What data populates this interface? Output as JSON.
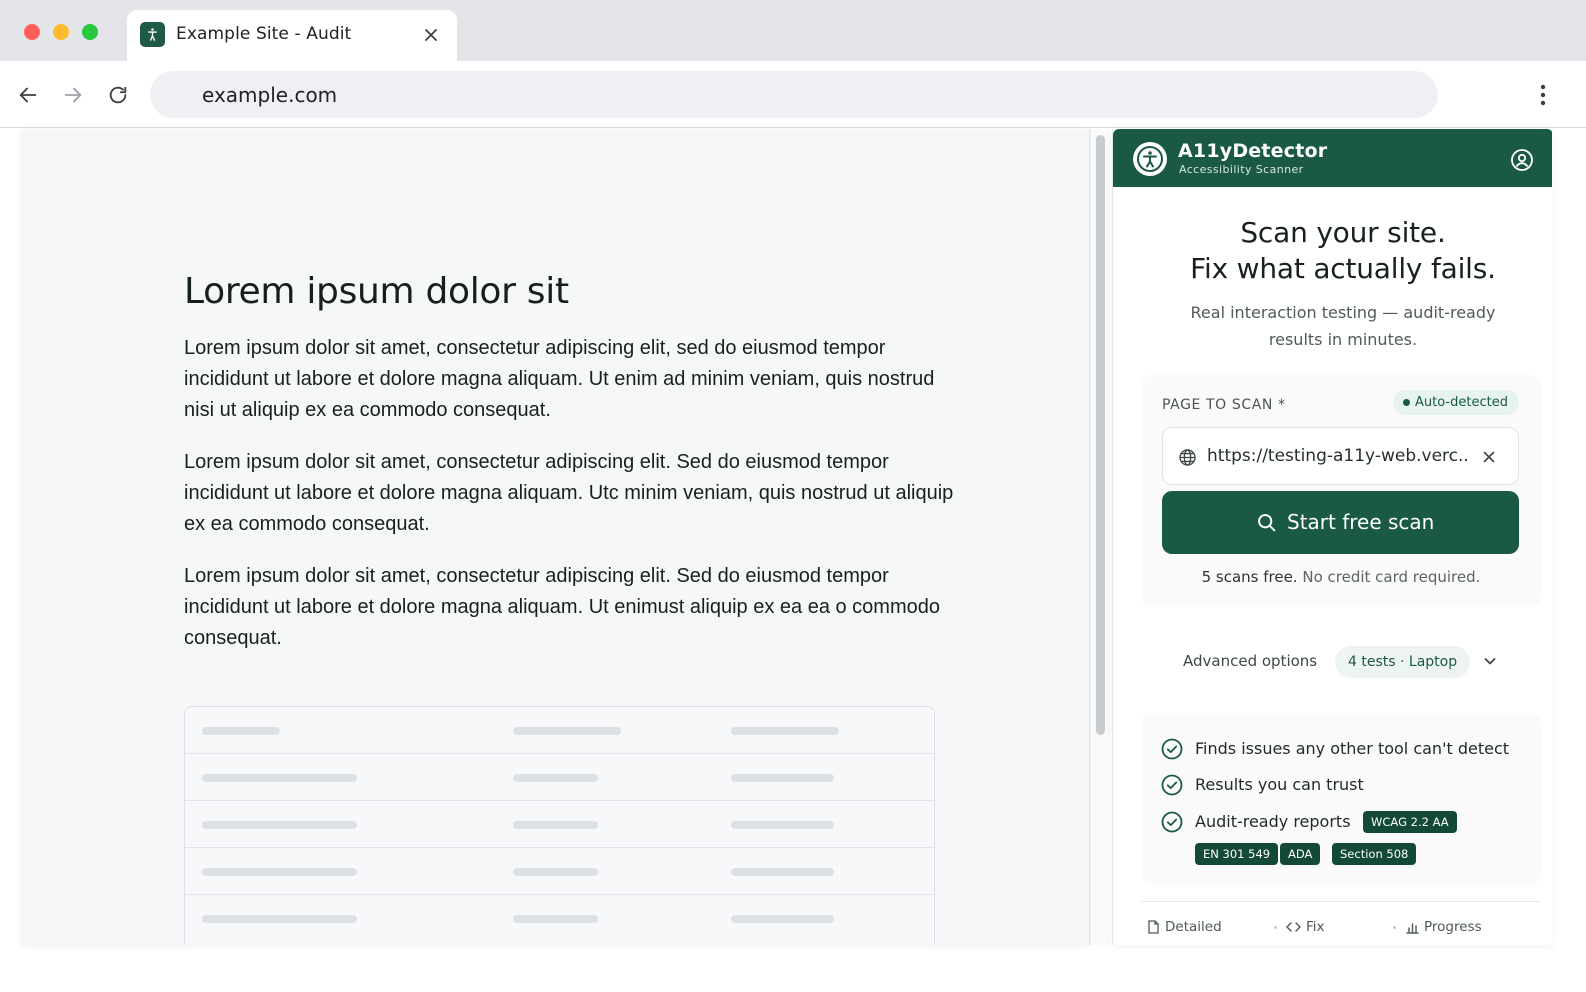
{
  "browser": {
    "tab": {
      "title": "Example Site - Audit",
      "favicon": "accessibility-person-icon"
    },
    "address_bar": {
      "url": "example.com"
    },
    "buttons": {
      "back": "arrow-left-icon",
      "forward": "arrow-right-icon",
      "reload": "reload-icon",
      "menu": "kebab-menu-icon"
    }
  },
  "page": {
    "heading": "Lorem ipsum dolor sit",
    "paragraphs": [
      "Lorem ipsum dolor sit amet, consectetur adipiscing elit, sed do eiusmod tempor incididunt ut labore et dolore magna aliquam. Ut enim ad minim veniam, quis nostrud nisi ut aliquip ex ea commodo consequat.",
      "Lorem ipsum dolor sit amet, consectetur adipiscing elit. Sed do eiusmod tempor incididunt ut labore et dolore magna aliquam. Utc minim veniam, quis nostrud ut aliquip ex ea commodo consequat.",
      "Lorem ipsum dolor sit amet, consectetur adipiscing elit. Sed do eiusmod tempor incididunt ut labore et dolore magna aliquam. Ut enimust aliquip ex ea ea o commodo consequat."
    ]
  },
  "extension": {
    "brand": {
      "name": "A11yDetector",
      "subtitle": "Accessibility Scanner"
    },
    "hero": {
      "title_line1": "Scan your site.",
      "title_line2": "Fix what actually fails.",
      "subtitle": "Real interaction testing — audit-ready results in minutes."
    },
    "scan": {
      "field_label": "PAGE TO SCAN *",
      "auto_badge": "Auto-detected",
      "url_value": "https://testing-a11y-web.verc...",
      "button_label": "Start free scan",
      "free_note_strong": "5 scans free.",
      "free_note_rest": " No credit card required."
    },
    "advanced": {
      "label": "Advanced options",
      "chip": "4 tests · Laptop"
    },
    "features": [
      "Finds issues any other tool can't detect",
      "Results you can trust",
      "Audit-ready reports"
    ],
    "standards": [
      "WCAG 2.2 AA",
      "EN 301 549",
      "ADA",
      "Section 508"
    ],
    "footer": [
      "Detailed",
      "Fix",
      "Progress"
    ]
  },
  "colors": {
    "brand_green": "#1a5a43",
    "badge_dark": "#134a37",
    "chip_bg": "#eef4f1"
  }
}
